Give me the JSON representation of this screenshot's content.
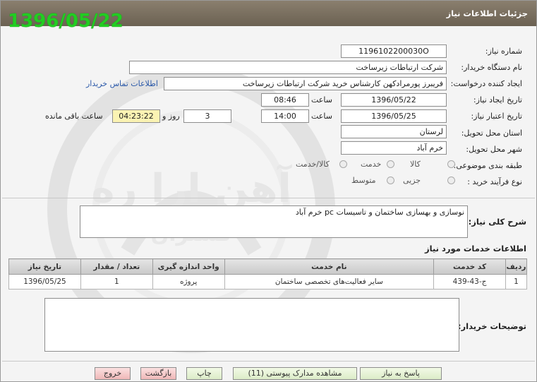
{
  "header": {
    "title": "جزئیات اطلاعات نیاز",
    "date_stamp": "1396/05/22"
  },
  "form": {
    "need_number_label": "شماره نیاز:",
    "need_number": "1196102200030O",
    "buyer_org_label": "نام دستگاه خریدار:",
    "buyer_org": "شرکت ارتباطات زیرساخت",
    "requester_label": "ایجاد کننده درخواست:",
    "requester": "فریبرز پورمرادکهن کارشناس خرید شرکت ارتباطات زیرساخت",
    "contact_link": "اطلاعات تماس خریدار",
    "created_label": "تاریخ ایجاد نیاز:",
    "created_date": "1396/05/22",
    "time_label": "ساعت",
    "created_time": "08:46",
    "valid_label": "تاریخ اعتبار نیاز:",
    "valid_date": "1396/05/25",
    "valid_time": "14:00",
    "days_value": "3",
    "days_label": "روز و",
    "remaining_time": "04:23:22",
    "remaining_label": "ساعت باقی مانده",
    "province_label": "استان محل تحویل:",
    "province": "لرستان",
    "city_label": "شهر محل تحویل:",
    "city": "خرم آباد",
    "category_label": "طبقه بندی موضوعی:",
    "category_options": [
      "کالا",
      "خدمت",
      "کالا/خدمت"
    ],
    "category_selected": "خدمت",
    "process_label": "نوع فرآیند خرید :",
    "process_options": [
      "جزیی",
      "متوسط"
    ],
    "process_selected": "متوسط"
  },
  "general_desc": {
    "label": "شرح کلی نیاز:",
    "text": "نوسازی و بهسازی ساختمان و تاسیسات pc خرم آباد"
  },
  "services": {
    "title": "اطلاعات خدمات مورد نیاز",
    "columns": [
      "ردیف",
      "کد خدمت",
      "نام خدمت",
      "واحد اندازه گیری",
      "تعداد / مقدار",
      "تاریخ نیاز"
    ],
    "rows": [
      [
        "1",
        "ج-43-439",
        "سایر فعالیت‌های تخصصی ساختمان",
        "پروژه",
        "1",
        "1396/05/25"
      ]
    ]
  },
  "buyer_notes": {
    "label": "توضیحات خریدار:",
    "text": ""
  },
  "buttons": {
    "reply": "پاسخ به نیاز",
    "attachments": "مشاهده مدارک پیوستی (11)",
    "print": "چاپ",
    "back": "بازگشت",
    "exit": "خروج"
  },
  "watermark": {
    "text": "آهن ارا ره",
    "subtext": "گستران"
  },
  "colors": {
    "title_bar": "#6b6152",
    "date_stamp": "#22cc22",
    "link": "#2a58a8",
    "remaining_bg": "#fbf3b3"
  }
}
